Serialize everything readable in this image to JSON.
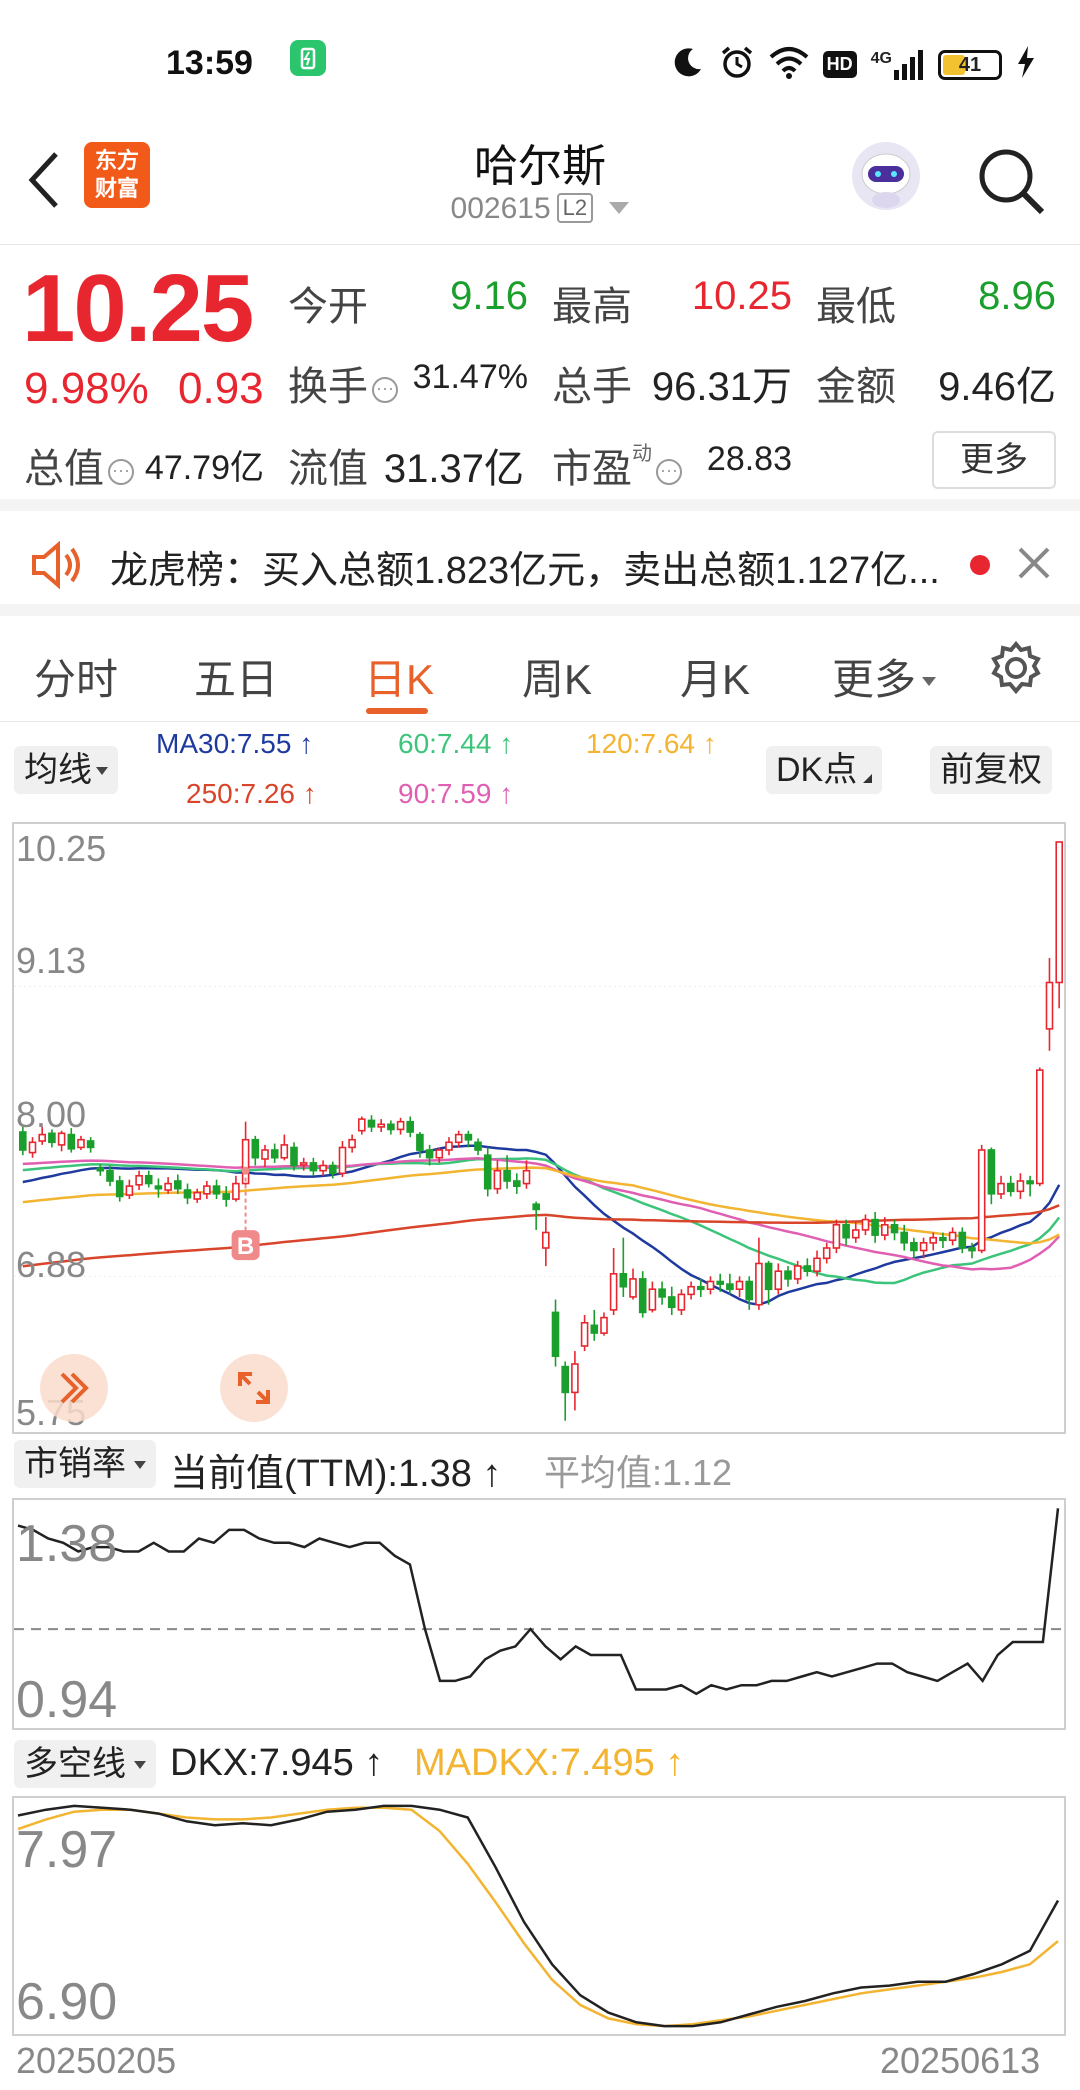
{
  "status": {
    "time": "13:59",
    "battery": "41",
    "network": "4G",
    "hd": "HD"
  },
  "header": {
    "logo_line1": "东方",
    "logo_line2": "财富",
    "stock_name": "哈尔斯",
    "stock_code": "002615",
    "level_badge": "L2"
  },
  "quote": {
    "price": "10.25",
    "change_pct": "9.98%",
    "change": "0.93",
    "open_label": "今开",
    "open": "9.16",
    "high_label": "最高",
    "high": "10.25",
    "low_label": "最低",
    "low": "8.96",
    "turnover_label": "换手",
    "turnover": "31.47%",
    "volume_label": "总手",
    "volume": "96.31万",
    "amount_label": "金额",
    "amount": "9.46亿",
    "mktcap_label": "总值",
    "mktcap": "47.79亿",
    "float_label": "流值",
    "float_cap": "31.37亿",
    "pe_label": "市盈",
    "pe_sup": "动",
    "pe": "28.83",
    "more_label": "更多"
  },
  "notice": {
    "text": "龙虎榜：买入总额1.823亿元，卖出总额1.127亿..."
  },
  "tabs": [
    "分时",
    "五日",
    "日K",
    "周K",
    "月K",
    "更多"
  ],
  "active_tab": "日K",
  "ma_bar": {
    "select_label": "均线",
    "ma30": "MA30:7.55",
    "ma60": "60:7.44",
    "ma120": "120:7.64",
    "ma250": "250:7.26",
    "ma90": "90:7.59",
    "dk_label": "DK点",
    "adjust_label": "前复权",
    "colors": {
      "ma30": "#1f3a9e",
      "ma60": "#3cc47a",
      "ma120": "#f2b431",
      "ma250": "#d8452a",
      "ma90": "#e05fb3"
    }
  },
  "kline": {
    "y_labels": [
      "10.25",
      "9.13",
      "8.00",
      "6.88",
      "5.75"
    ],
    "buy_marker": "B",
    "arrow_icon": "double-chevron-right-icon",
    "expand_icon": "expand-icon"
  },
  "ps_panel": {
    "select_label": "市销率",
    "current": "当前值(TTM):1.38",
    "average": "平均值:1.12",
    "y_labels": [
      "1.38",
      "0.94"
    ]
  },
  "dkx_panel": {
    "select_label": "多空线",
    "dkx": "DKX:7.945",
    "madkx": "MADKX:7.495",
    "y_labels": [
      "7.97",
      "6.90"
    ]
  },
  "x_axis": {
    "start": "20250205",
    "end": "20250613"
  },
  "chart_data": {
    "type": "candlestick",
    "ylim": [
      5.75,
      10.25
    ],
    "candles": [
      [
        8.0,
        7.86,
        8.05,
        7.82
      ],
      [
        7.84,
        7.92,
        7.96,
        7.8
      ],
      [
        7.93,
        7.98,
        8.04,
        7.9
      ],
      [
        7.99,
        7.92,
        8.02,
        7.88
      ],
      [
        7.9,
        7.99,
        8.01,
        7.85
      ],
      [
        7.98,
        7.87,
        8.03,
        7.84
      ],
      [
        7.88,
        7.94,
        7.97,
        7.86
      ],
      [
        7.93,
        7.88,
        7.96,
        7.84
      ],
      [
        7.72,
        7.7,
        7.75,
        7.66
      ],
      [
        7.7,
        7.62,
        7.74,
        7.58
      ],
      [
        7.62,
        7.5,
        7.66,
        7.46
      ],
      [
        7.51,
        7.58,
        7.63,
        7.48
      ],
      [
        7.59,
        7.66,
        7.7,
        7.55
      ],
      [
        7.66,
        7.6,
        7.7,
        7.57
      ],
      [
        7.58,
        7.56,
        7.64,
        7.49
      ],
      [
        7.55,
        7.6,
        7.65,
        7.52
      ],
      [
        7.62,
        7.56,
        7.67,
        7.52
      ],
      [
        7.55,
        7.49,
        7.6,
        7.44
      ],
      [
        7.48,
        7.53,
        7.56,
        7.45
      ],
      [
        7.52,
        7.58,
        7.62,
        7.48
      ],
      [
        7.58,
        7.52,
        7.63,
        7.48
      ],
      [
        7.52,
        7.48,
        7.58,
        7.42
      ],
      [
        7.48,
        7.6,
        7.66,
        7.46
      ],
      [
        7.6,
        7.94,
        8.08,
        7.57
      ],
      [
        7.94,
        7.8,
        7.97,
        7.74
      ],
      [
        7.79,
        7.86,
        7.9,
        7.73
      ],
      [
        7.86,
        7.8,
        7.91,
        7.76
      ],
      [
        7.8,
        7.9,
        7.98,
        7.78
      ],
      [
        7.88,
        7.74,
        7.92,
        7.7
      ],
      [
        7.75,
        7.76,
        7.8,
        7.7
      ],
      [
        7.76,
        7.7,
        7.8,
        7.66
      ],
      [
        7.7,
        7.74,
        7.78,
        7.66
      ],
      [
        7.74,
        7.68,
        7.77,
        7.64
      ],
      [
        7.68,
        7.88,
        7.93,
        7.65
      ],
      [
        7.88,
        7.94,
        7.98,
        7.84
      ],
      [
        8.01,
        8.1,
        8.12,
        7.98
      ],
      [
        8.09,
        8.04,
        8.13,
        8.0
      ],
      [
        8.04,
        8.06,
        8.1,
        8.0
      ],
      [
        8.06,
        8.02,
        8.09,
        7.98
      ],
      [
        8.02,
        8.08,
        8.11,
        7.98
      ],
      [
        8.08,
        8.0,
        8.12,
        7.96
      ],
      [
        7.98,
        7.86,
        8.0,
        7.8
      ],
      [
        7.86,
        7.8,
        7.9,
        7.74
      ],
      [
        7.8,
        7.86,
        7.88,
        7.76
      ],
      [
        7.86,
        7.92,
        7.96,
        7.82
      ],
      [
        7.92,
        7.98,
        8.01,
        7.88
      ],
      [
        7.98,
        7.94,
        8.01,
        7.88
      ],
      [
        7.92,
        7.86,
        7.95,
        7.82
      ],
      [
        7.82,
        7.56,
        7.88,
        7.5
      ],
      [
        7.56,
        7.7,
        7.78,
        7.52
      ],
      [
        7.7,
        7.62,
        7.82,
        7.56
      ],
      [
        7.62,
        7.58,
        7.68,
        7.52
      ],
      [
        7.6,
        7.7,
        7.78,
        7.56
      ],
      [
        7.44,
        7.4,
        7.46,
        7.24
      ],
      [
        7.1,
        7.22,
        7.34,
        6.96
      ],
      [
        6.6,
        6.26,
        6.7,
        6.18
      ],
      [
        6.18,
        5.98,
        6.22,
        5.76
      ],
      [
        5.98,
        6.2,
        6.3,
        5.84
      ],
      [
        6.34,
        6.52,
        6.58,
        6.3
      ],
      [
        6.5,
        6.44,
        6.62,
        6.38
      ],
      [
        6.44,
        6.56,
        6.6,
        6.42
      ],
      [
        6.62,
        6.9,
        7.1,
        6.58
      ],
      [
        6.9,
        6.8,
        7.18,
        6.72
      ],
      [
        6.72,
        6.86,
        6.94,
        6.7
      ],
      [
        6.86,
        6.6,
        6.92,
        6.56
      ],
      [
        6.62,
        6.78,
        6.84,
        6.6
      ],
      [
        6.78,
        6.72,
        6.84,
        6.66
      ],
      [
        6.72,
        6.64,
        6.8,
        6.58
      ],
      [
        6.62,
        6.74,
        6.78,
        6.58
      ],
      [
        6.74,
        6.8,
        6.84,
        6.7
      ],
      [
        6.8,
        6.78,
        6.86,
        6.72
      ],
      [
        6.78,
        6.84,
        6.88,
        6.74
      ],
      [
        6.84,
        6.82,
        6.9,
        6.76
      ],
      [
        6.82,
        6.78,
        6.9,
        6.74
      ],
      [
        6.78,
        6.84,
        6.88,
        6.72
      ],
      [
        6.84,
        6.7,
        6.88,
        6.62
      ],
      [
        6.66,
        6.98,
        7.18,
        6.62
      ],
      [
        6.98,
        6.78,
        7.0,
        6.66
      ],
      [
        6.78,
        6.92,
        6.98,
        6.74
      ],
      [
        6.92,
        6.86,
        6.96,
        6.8
      ],
      [
        6.86,
        6.96,
        7.0,
        6.82
      ],
      [
        6.96,
        6.92,
        7.02,
        6.88
      ],
      [
        6.92,
        7.02,
        7.08,
        6.88
      ],
      [
        7.02,
        7.1,
        7.14,
        6.98
      ],
      [
        7.1,
        7.28,
        7.32,
        7.06
      ],
      [
        7.28,
        7.18,
        7.32,
        7.12
      ],
      [
        7.18,
        7.24,
        7.3,
        7.14
      ],
      [
        7.24,
        7.32,
        7.36,
        7.2
      ],
      [
        7.32,
        7.2,
        7.38,
        7.14
      ],
      [
        7.2,
        7.28,
        7.34,
        7.16
      ],
      [
        7.28,
        7.22,
        7.32,
        7.16
      ],
      [
        7.22,
        7.14,
        7.28,
        7.08
      ],
      [
        7.14,
        7.08,
        7.18,
        7.02
      ],
      [
        7.08,
        7.14,
        7.18,
        7.02
      ],
      [
        7.14,
        7.18,
        7.22,
        7.08
      ],
      [
        7.18,
        7.16,
        7.22,
        7.1
      ],
      [
        7.16,
        7.22,
        7.26,
        7.12
      ],
      [
        7.22,
        7.1,
        7.26,
        7.06
      ],
      [
        7.1,
        7.08,
        7.14,
        7.02
      ],
      [
        7.08,
        7.86,
        7.9,
        7.06
      ],
      [
        7.86,
        7.52,
        7.88,
        7.44
      ],
      [
        7.52,
        7.6,
        7.66,
        7.48
      ],
      [
        7.6,
        7.54,
        7.66,
        7.5
      ],
      [
        7.54,
        7.62,
        7.68,
        7.48
      ],
      [
        7.62,
        7.6,
        7.66,
        7.5
      ],
      [
        7.6,
        8.48,
        8.5,
        7.58
      ],
      [
        8.8,
        9.16,
        9.35,
        8.63
      ],
      [
        9.16,
        10.25,
        10.25,
        8.96
      ]
    ],
    "ps_line": [
      1.36,
      1.35,
      1.33,
      1.32,
      1.3,
      1.31,
      1.31,
      1.3,
      1.3,
      1.32,
      1.3,
      1.3,
      1.33,
      1.32,
      1.35,
      1.35,
      1.33,
      1.32,
      1.32,
      1.31,
      1.33,
      1.32,
      1.31,
      1.32,
      1.32,
      1.29,
      1.27,
      1.12,
      1.0,
      1.0,
      1.01,
      1.05,
      1.07,
      1.08,
      1.12,
      1.08,
      1.05,
      1.08,
      1.06,
      1.06,
      1.06,
      0.98,
      0.98,
      0.98,
      0.99,
      0.97,
      0.99,
      0.98,
      0.99,
      0.99,
      1.0,
      1.0,
      1.01,
      1.02,
      1.01,
      1.02,
      1.03,
      1.04,
      1.04,
      1.02,
      1.01,
      1.0,
      1.02,
      1.04,
      1.0,
      1.06,
      1.09,
      1.09,
      1.09,
      1.4
    ],
    "dkx": [
      7.95,
      7.98,
      8.0,
      7.99,
      7.98,
      7.96,
      7.92,
      7.9,
      7.91,
      7.9,
      7.93,
      7.97,
      7.98,
      8.0,
      8.0,
      7.98,
      7.94,
      7.68,
      7.4,
      7.18,
      7.02,
      6.93,
      6.88,
      6.86,
      6.86,
      6.88,
      6.92,
      6.96,
      6.99,
      7.03,
      7.06,
      7.07,
      7.09,
      7.09,
      7.13,
      7.18,
      7.25,
      7.51
    ],
    "madkx": [
      7.88,
      7.93,
      7.97,
      7.98,
      7.98,
      7.96,
      7.94,
      7.93,
      7.93,
      7.94,
      7.96,
      7.98,
      7.99,
      7.99,
      7.98,
      7.87,
      7.7,
      7.5,
      7.29,
      7.1,
      6.97,
      6.9,
      6.87,
      6.86,
      6.87,
      6.89,
      6.91,
      6.94,
      6.97,
      7.0,
      7.03,
      7.05,
      7.07,
      7.09,
      7.11,
      7.14,
      7.18,
      7.3
    ]
  }
}
